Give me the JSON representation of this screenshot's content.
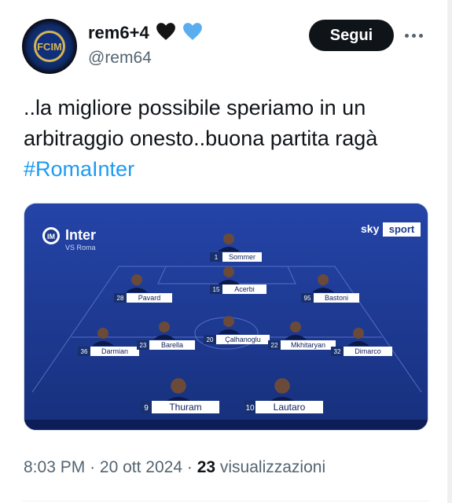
{
  "user": {
    "display_name": "rem6+4",
    "handle": "@rem64",
    "avatar_label": "FCIM"
  },
  "follow_label": "Segui",
  "tweet": {
    "text": "..la migliore possibile speriamo in un arbitraggio onesto..buona partita ragà",
    "hashtag": "#RomaInter"
  },
  "graphic": {
    "team": "Inter",
    "subtitle": "VS Roma",
    "broadcaster_sky": "sky",
    "broadcaster_sport": "sport",
    "players": [
      {
        "number": "1",
        "name": "Sommer"
      },
      {
        "number": "15",
        "name": "Acerbi"
      },
      {
        "number": "28",
        "name": "Pavard"
      },
      {
        "number": "95",
        "name": "Bastoni"
      },
      {
        "number": "36",
        "name": "Darmian"
      },
      {
        "number": "23",
        "name": "Barella"
      },
      {
        "number": "20",
        "name": "Çalhanoglu"
      },
      {
        "number": "22",
        "name": "Mkhitaryan"
      },
      {
        "number": "32",
        "name": "Dimarco"
      },
      {
        "number": "9",
        "name": "Thuram"
      },
      {
        "number": "10",
        "name": "Lautaro"
      }
    ]
  },
  "meta": {
    "time": "8:03 PM",
    "sep1": "·",
    "date": "20 ott 2024",
    "sep2": "·",
    "views_count": "23",
    "views_label": "visualizzazioni"
  },
  "colors": {
    "accent": "#1d9bf0",
    "pitch": "#1e3a8f",
    "heart_black": "#141414",
    "heart_blue": "#5aaef0"
  }
}
